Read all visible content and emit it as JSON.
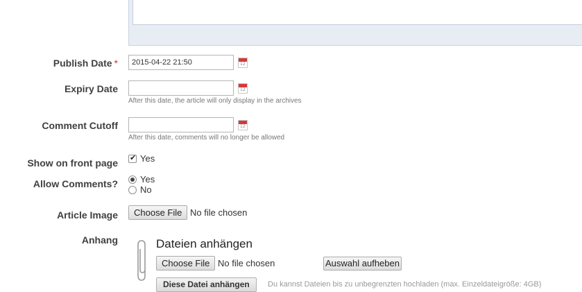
{
  "fields": {
    "publish_date": {
      "label": "Publish Date",
      "required_marker": "*",
      "value": "2015-04-22 21:50"
    },
    "expiry_date": {
      "label": "Expiry Date",
      "value": "",
      "hint": "After this date, the article will only display in the archives"
    },
    "comment_cutoff": {
      "label": "Comment Cutoff",
      "value": "",
      "hint": "After this date, comments will no longer be allowed"
    },
    "show_on_front_page": {
      "label": "Show on front page",
      "option": "Yes",
      "checked": true
    },
    "allow_comments": {
      "label": "Allow Comments?",
      "options": [
        "Yes",
        "No"
      ],
      "selected": "Yes"
    },
    "article_image": {
      "label": "Article Image",
      "button": "Choose File",
      "status": "No file chosen"
    },
    "anhang": {
      "label": "Anhang",
      "title": "Dateien anhängen",
      "button": "Choose File",
      "status": "No file chosen",
      "clear_button": "Auswahl aufheben",
      "upload_button": "Diese Datei anhängen",
      "upload_info": "Du kannst Dateien bis zu unbegrenzten hochladen (max. Einzeldateigröße: 4GB)"
    }
  },
  "icons": {
    "calendar": "calendar-icon",
    "calendar_day": "12",
    "attachment": "paperclip-icon"
  },
  "colors": {
    "label_text": "#404040",
    "required": "#cc3333",
    "hint_text": "#777777",
    "calendar_red": "#d43a3a",
    "editor_bg": "#e8edf4"
  }
}
